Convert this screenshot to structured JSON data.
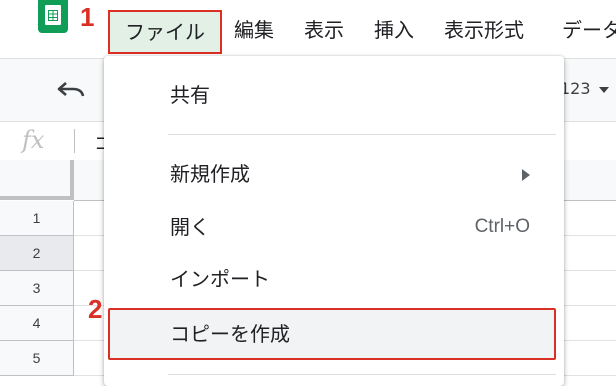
{
  "annotations": {
    "step1": "1",
    "step2": "2"
  },
  "menu": {
    "file": "ファイル",
    "edit": "編集",
    "view": "表示",
    "insert": "挿入",
    "format": "表示形式",
    "data_partial": "データ"
  },
  "toolbar": {
    "number_format": "123"
  },
  "formula_bar": {
    "fx": "fx",
    "text": "コ"
  },
  "rows": [
    "1",
    "2",
    "3",
    "4",
    "5"
  ],
  "selected_row": "2",
  "file_menu": {
    "share": "共有",
    "new": "新規作成",
    "open": "開く",
    "open_shortcut": "Ctrl+O",
    "import": "インポート",
    "make_copy": "コピーを作成"
  },
  "colors": {
    "accent_red": "#d93025",
    "sheets_green": "#0f9d58",
    "menu_active_bg": "#e3f0e6"
  },
  "icons": [
    "sheets-logo-icon",
    "undo-icon",
    "fx-icon",
    "submenu-arrow-icon",
    "caret-down-icon"
  ]
}
